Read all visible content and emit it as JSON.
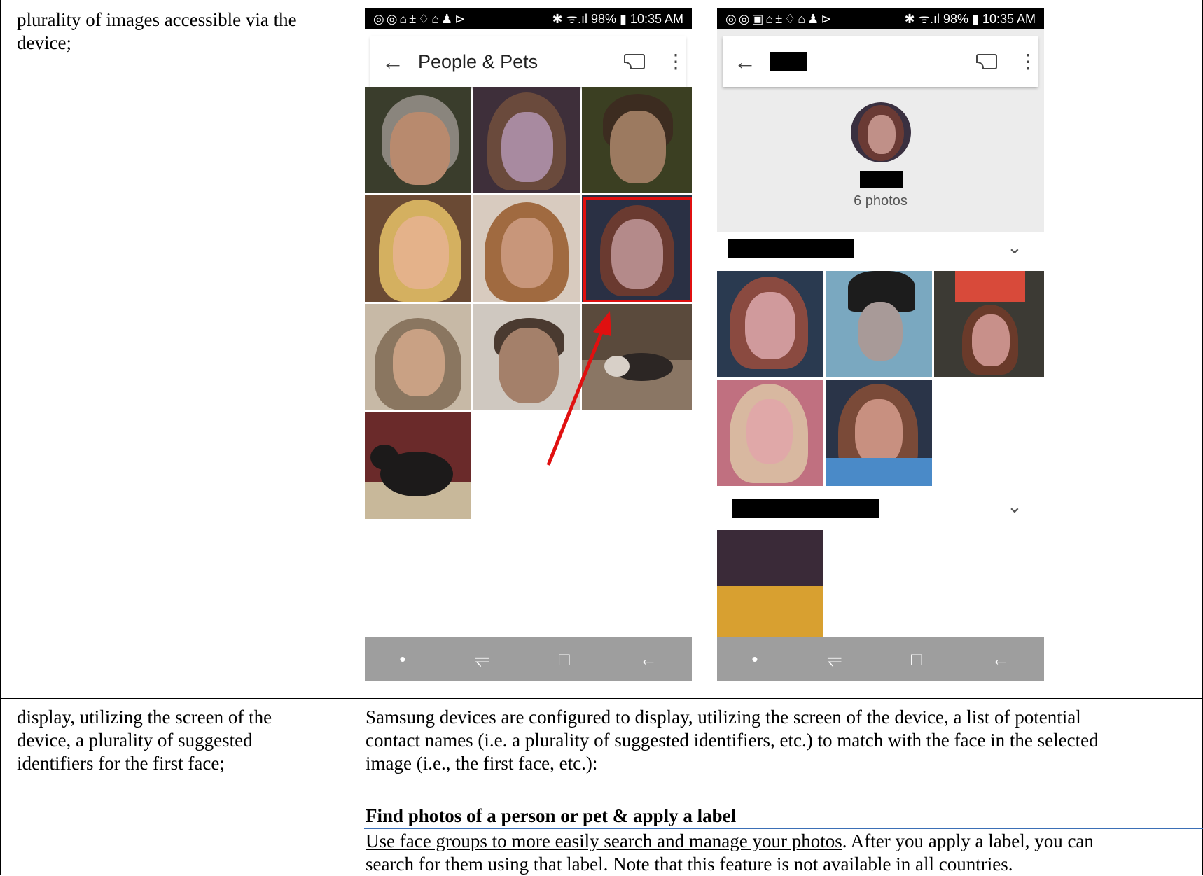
{
  "row1": {
    "left_text_lines": [
      "plurality of images accessible via the",
      "device;"
    ]
  },
  "row2": {
    "left_text_lines": [
      "display, utilizing the screen of the",
      "device, a plurality of suggested",
      "identifiers for the first face;"
    ],
    "right_paragraph_lines": [
      "Samsung devices are configured to display, utilizing the screen of the device, a list of potential",
      "contact names (i.e. a plurality of suggested identifiers, etc.) to match with the face in the selected",
      "image (i.e., the first face, etc.):"
    ],
    "section_heading": "Find photos of a person or pet & apply a label",
    "link_text": "Use face groups to more easily search and manage your photos",
    "after_link": ". After you apply a label, you can",
    "last_line": "search for them using that label. Note that this feature is not available in all countries."
  },
  "phone_left": {
    "status_icons": "◎◎⌂±♢⌂♟⊳",
    "status_right": "✱ ᯤ.ıl 98% ▮ 10:35 AM",
    "back_icon": "←",
    "title": "People & Pets",
    "more_icon": "⋮",
    "nav": [
      "•",
      "⥫",
      "□",
      "←"
    ]
  },
  "phone_right": {
    "status_icons": "◎◎▣⌂±♢⌂♟⊳",
    "status_right": "✱ ᯤ.ıl 98% ▮ 10:35 AM",
    "back_icon": "←",
    "more_icon": "⋮",
    "photo_count": "6 photos",
    "chevron": "⌄",
    "nav": [
      "•",
      "⥫",
      "□",
      "←"
    ]
  },
  "colors": {
    "highlight_box": "#e01010",
    "arrow": "#e01010",
    "navbar": "#9e9e9e",
    "rule": "#3b6fb6"
  }
}
